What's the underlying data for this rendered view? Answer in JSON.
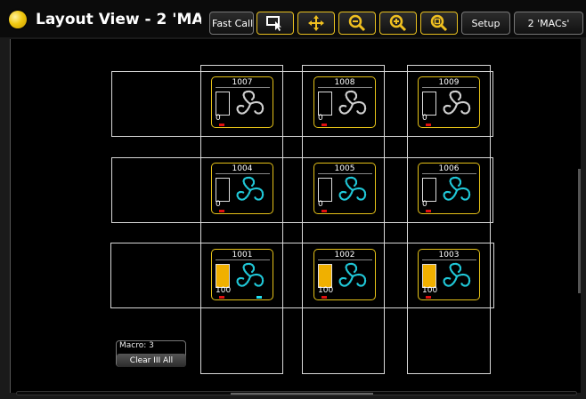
{
  "window": {
    "title": "Layout View - 2 'MA"
  },
  "toolbar": {
    "fast_call_label": "Fast Call",
    "buttons": [
      {
        "name": "select-tool",
        "icon": "select-arrow-icon"
      },
      {
        "name": "move-tool",
        "icon": "move-icon"
      },
      {
        "name": "zoom-out-tool",
        "icon": "zoom-out-icon"
      },
      {
        "name": "zoom-in-tool",
        "icon": "zoom-in-icon"
      },
      {
        "name": "zoom-fit-tool",
        "icon": "zoom-fit-icon"
      }
    ],
    "setup_label": "Setup",
    "layout_label": "2 'MACs'",
    "accent_color": "#e8c020"
  },
  "fixtures": [
    {
      "id": "1007",
      "value": "0",
      "level": 0,
      "gobo_color": "#d0d0d0",
      "cyan_mark": false
    },
    {
      "id": "1008",
      "value": "0",
      "level": 0,
      "gobo_color": "#d0d0d0",
      "cyan_mark": false
    },
    {
      "id": "1009",
      "value": "0",
      "level": 0,
      "gobo_color": "#d0d0d0",
      "cyan_mark": false
    },
    {
      "id": "1004",
      "value": "0",
      "level": 0,
      "gobo_color": "#20c8d8",
      "cyan_mark": false
    },
    {
      "id": "1005",
      "value": "0",
      "level": 0,
      "gobo_color": "#20c8d8",
      "cyan_mark": false
    },
    {
      "id": "1006",
      "value": "0",
      "level": 0,
      "gobo_color": "#20c8d8",
      "cyan_mark": false
    },
    {
      "id": "1001",
      "value": "100",
      "level": 1,
      "gobo_color": "#20c8d8",
      "cyan_mark": true
    },
    {
      "id": "1002",
      "value": "100",
      "level": 1,
      "gobo_color": "#20c8d8",
      "cyan_mark": false
    },
    {
      "id": "1003",
      "value": "100",
      "level": 1,
      "gobo_color": "#20c8d8",
      "cyan_mark": false
    }
  ],
  "macro": {
    "label": "Macro: 3",
    "clear_button": "Clear III All"
  },
  "colors": {
    "fixture_border": "#e6c218",
    "dimmer_fill": "#f0b000",
    "selection_red": "#e01010"
  }
}
